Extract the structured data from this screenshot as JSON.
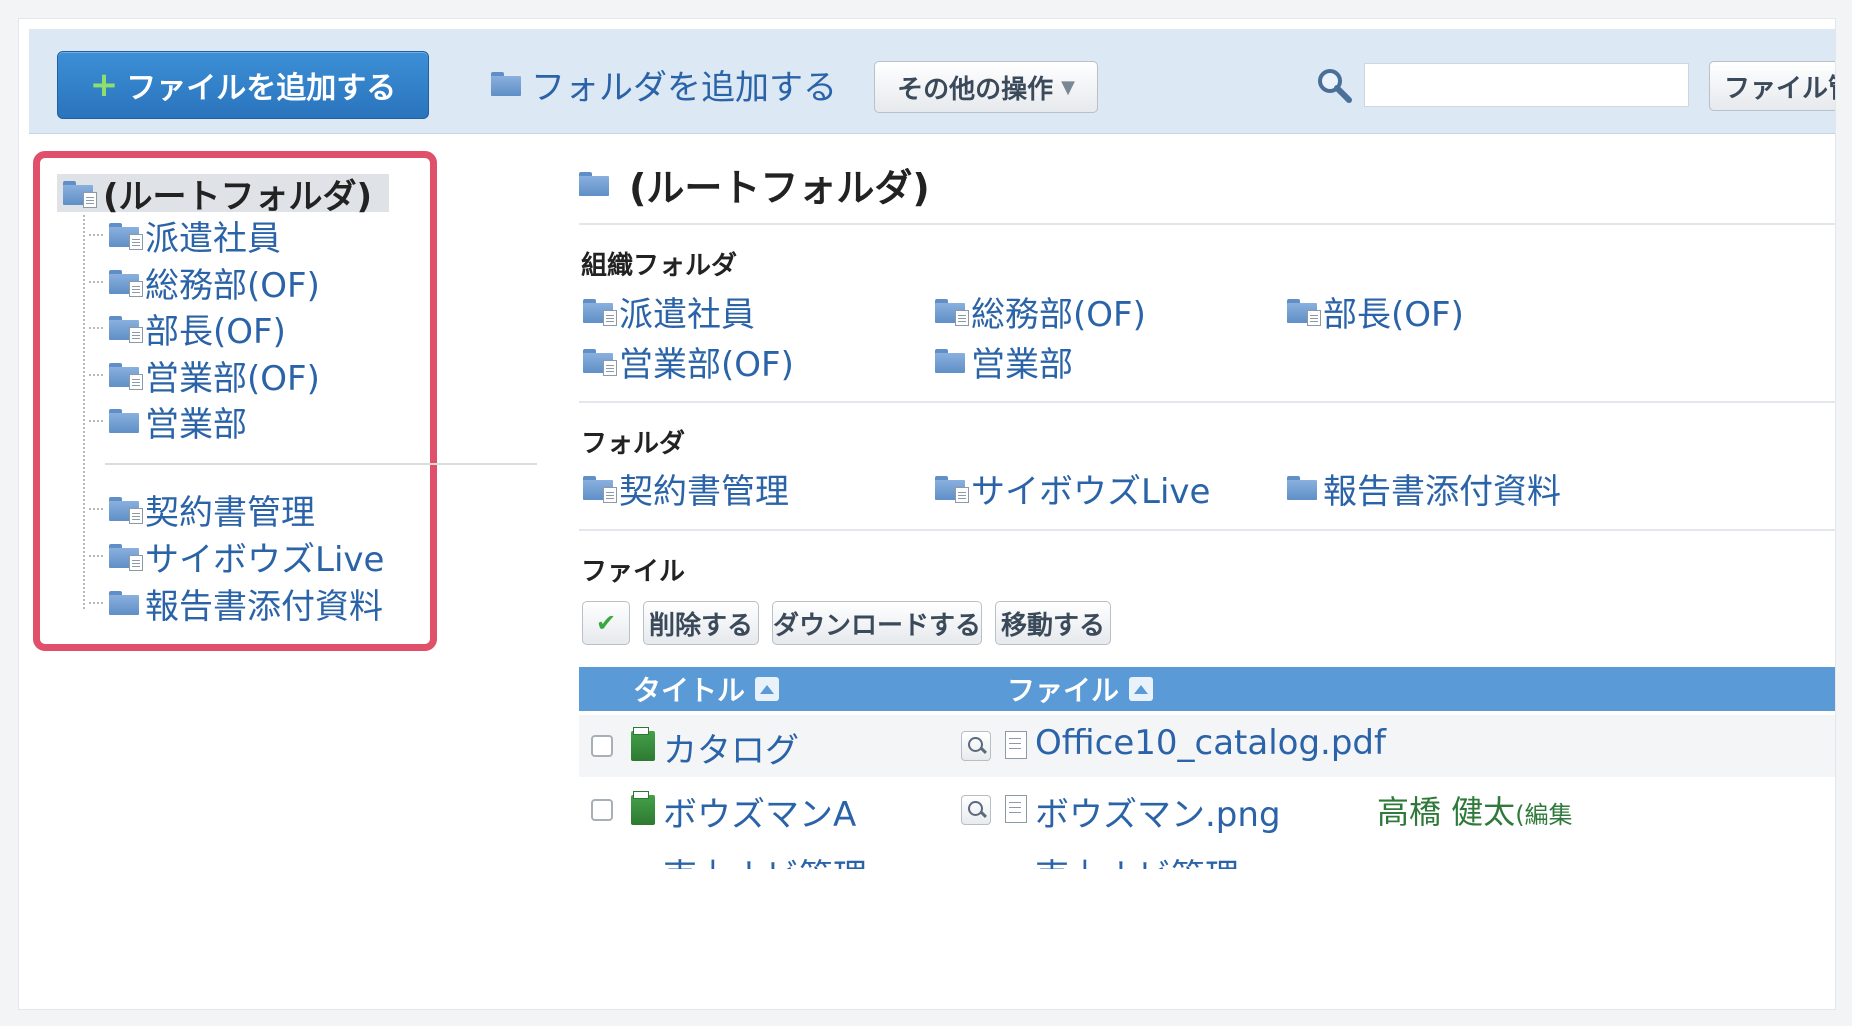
{
  "toolbar": {
    "add_file_label": "ファイルを追加する",
    "add_folder_label": "フォルダを追加する",
    "more_ops_label": "その他の操作",
    "search_value": "",
    "file_mgmt_label": "ファイル管"
  },
  "tree": {
    "root": "(ルートフォルダ)",
    "group1": [
      "派遣社員",
      "総務部(OF)",
      "部長(OF)",
      "営業部(OF)",
      "営業部"
    ],
    "group2": [
      "契約書管理",
      "サイボウズLive",
      "報告書添付資料"
    ]
  },
  "main": {
    "title": "(ルートフォルダ)",
    "org_label": "組織フォルダ",
    "org_folders": [
      "派遣社員",
      "総務部(OF)",
      "部長(OF)",
      "営業部(OF)",
      "営業部"
    ],
    "folder_label": "フォルダ",
    "folders": [
      "契約書管理",
      "サイボウズLive",
      "報告書添付資料"
    ],
    "file_label": "ファイル",
    "actions": {
      "delete": "削除する",
      "download": "ダウンロードする",
      "move": "移動する"
    },
    "columns": {
      "title": "タイトル",
      "file": "ファイル"
    },
    "rows": [
      {
        "title": "カタログ",
        "file": "Office10_catalog.pdf",
        "user": ""
      },
      {
        "title": "ボウズマンA",
        "file": "ボウズマン.png",
        "user_name": "高橋 健太",
        "user_suffix": "(編集"
      }
    ],
    "cut_row": {
      "title": "売上ナビ管理",
      "file": "売上ナビ管理"
    }
  },
  "colors": {
    "accent": "#2a74bd",
    "link": "#2a63a8",
    "highlight": "#e0506a",
    "header": "#5a9ad6"
  }
}
